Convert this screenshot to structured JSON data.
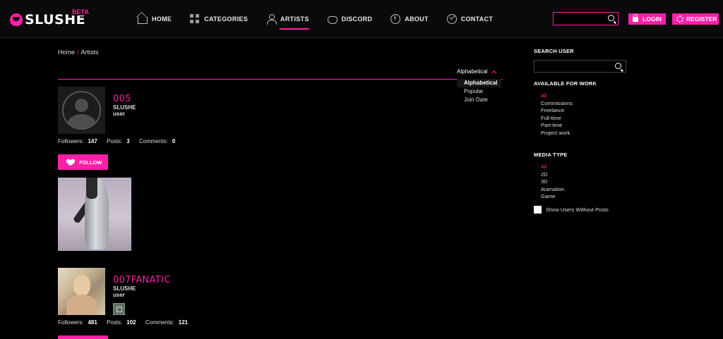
{
  "logo": {
    "text": "SLUSHE",
    "badge": "BETA"
  },
  "nav": {
    "items": [
      {
        "label": "HOME",
        "icon": "home-icon"
      },
      {
        "label": "CATEGORIES",
        "icon": "grid-icon"
      },
      {
        "label": "ARTISTS",
        "icon": "user-icon",
        "active": true
      },
      {
        "label": "DISCORD",
        "icon": "discord-icon"
      },
      {
        "label": "ABOUT",
        "icon": "info-icon"
      },
      {
        "label": "CONTACT",
        "icon": "check-circle-icon"
      }
    ],
    "search_placeholder": "",
    "login_label": "LOGIN",
    "register_label": "REGISTER"
  },
  "breadcrumb": {
    "home": "Home",
    "sep": "/",
    "current": "Artists"
  },
  "sort": {
    "current": "Alphabetical",
    "options": [
      "Alphabetical",
      "Popular",
      "Join Date"
    ]
  },
  "artists": [
    {
      "name": "005",
      "subtitle": "SLUSHE user",
      "followers_label": "Followers:",
      "followers": "147",
      "posts_label": "Posts:",
      "posts": "3",
      "comments_label": "Comments:",
      "comments": "0",
      "follow_label": "FOLLOW"
    },
    {
      "name": "007FANATIC",
      "subtitle": "SLUSHE user",
      "followers_label": "Followers:",
      "followers": "481",
      "posts_label": "Posts:",
      "posts": "102",
      "comments_label": "Comments:",
      "comments": "121",
      "follow_label": ""
    }
  ],
  "sidebar": {
    "search_title": "SEARCH USER",
    "search_placeholder": "",
    "work_title": "AVAILABLE FOR WORK",
    "work_options": [
      "All",
      "Commissions",
      "Freelance",
      "Full-time",
      "Part-time",
      "Project work"
    ],
    "media_title": "MEDIA TYPE",
    "media_options": [
      "All",
      "2D",
      "3D",
      "Animation",
      "Game"
    ],
    "show_without_posts": "Show Users Without Posts"
  },
  "colors": {
    "accent": "#ff1fa8",
    "background": "#000000"
  }
}
